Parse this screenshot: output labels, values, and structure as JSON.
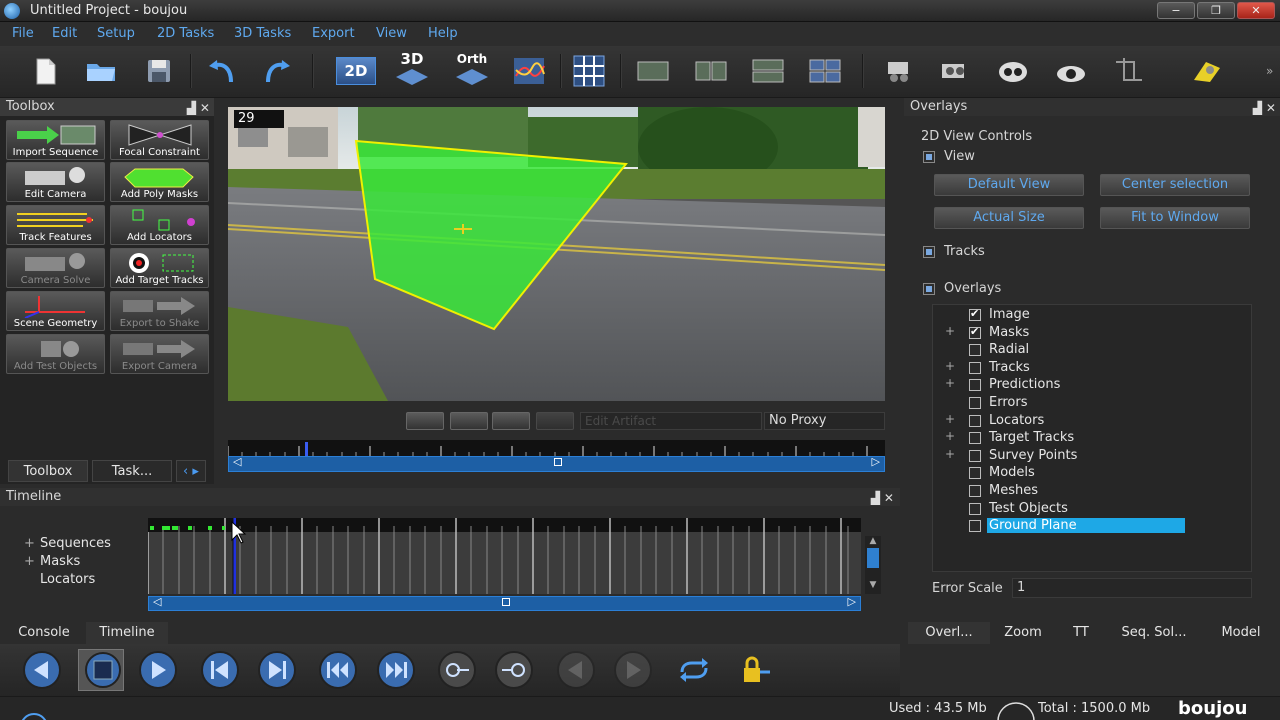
{
  "window": {
    "title": "Untitled Project - boujou",
    "controls": [
      "−",
      "❐",
      "✕"
    ]
  },
  "menu": [
    "File",
    "Edit",
    "Setup",
    "2D Tasks",
    "3D Tasks",
    "Export",
    "View",
    "Help"
  ],
  "toolbar": {
    "view_2d_label": "2D",
    "view_3d_label": "3D",
    "view_orth_label": "Orth"
  },
  "toolbox": {
    "title": "Toolbox",
    "tools": [
      {
        "label": "Import Sequence",
        "enabled": true
      },
      {
        "label": "Focal Constraint",
        "enabled": true
      },
      {
        "label": "Edit Camera",
        "enabled": true
      },
      {
        "label": "Add Poly Masks",
        "enabled": true
      },
      {
        "label": "Track Features",
        "enabled": true
      },
      {
        "label": "Add Locators",
        "enabled": true
      },
      {
        "label": "Camera Solve",
        "enabled": false
      },
      {
        "label": "Add Target Tracks",
        "enabled": true
      },
      {
        "label": "Scene Geometry",
        "enabled": true
      },
      {
        "label": "Export to Shake",
        "enabled": false
      },
      {
        "label": "Add Test Objects",
        "enabled": false
      },
      {
        "label": "Export Camera",
        "enabled": false
      }
    ],
    "tabs": [
      "Toolbox",
      "Task..."
    ]
  },
  "viewer": {
    "frame_number": "29",
    "edit_artifact_placeholder": "Edit Artifact",
    "proxy": "No Proxy"
  },
  "overlays": {
    "title": "Overlays",
    "section_title": "2D View Controls",
    "view_label": "View",
    "buttons": [
      "Default View",
      "Center selection",
      "Actual Size",
      "Fit to Window"
    ],
    "tracks_label": "Tracks",
    "overlays_label": "Overlays",
    "tree": [
      {
        "label": "Image",
        "checked": true,
        "expandable": false
      },
      {
        "label": "Masks",
        "checked": true,
        "expandable": true
      },
      {
        "label": "Radial",
        "checked": false,
        "expandable": false
      },
      {
        "label": "Tracks",
        "checked": false,
        "expandable": true
      },
      {
        "label": "Predictions",
        "checked": false,
        "expandable": true
      },
      {
        "label": "Errors",
        "checked": false,
        "expandable": false
      },
      {
        "label": "Locators",
        "checked": false,
        "expandable": true
      },
      {
        "label": "Target Tracks",
        "checked": false,
        "expandable": true
      },
      {
        "label": "Survey Points",
        "checked": false,
        "expandable": true
      },
      {
        "label": "Models",
        "checked": false,
        "expandable": false
      },
      {
        "label": "Meshes",
        "checked": false,
        "expandable": false
      },
      {
        "label": "Test Objects",
        "checked": false,
        "expandable": false
      },
      {
        "label": "Ground Plane",
        "checked": false,
        "expandable": false,
        "selected": true
      }
    ],
    "error_scale_label": "Error Scale",
    "error_scale_value": "1",
    "tabs": [
      "Overl...",
      "Zoom",
      "TT",
      "Seq. Sol...",
      "Model"
    ]
  },
  "timeline": {
    "title": "Timeline",
    "rows": [
      "Sequences",
      "Masks",
      "Locators"
    ]
  },
  "bottom_tabs": [
    "Console",
    "Timeline"
  ],
  "status": {
    "used": "Used : 43.5 Mb",
    "total": "Total : 1500.0 Mb",
    "brand": "boujou"
  }
}
